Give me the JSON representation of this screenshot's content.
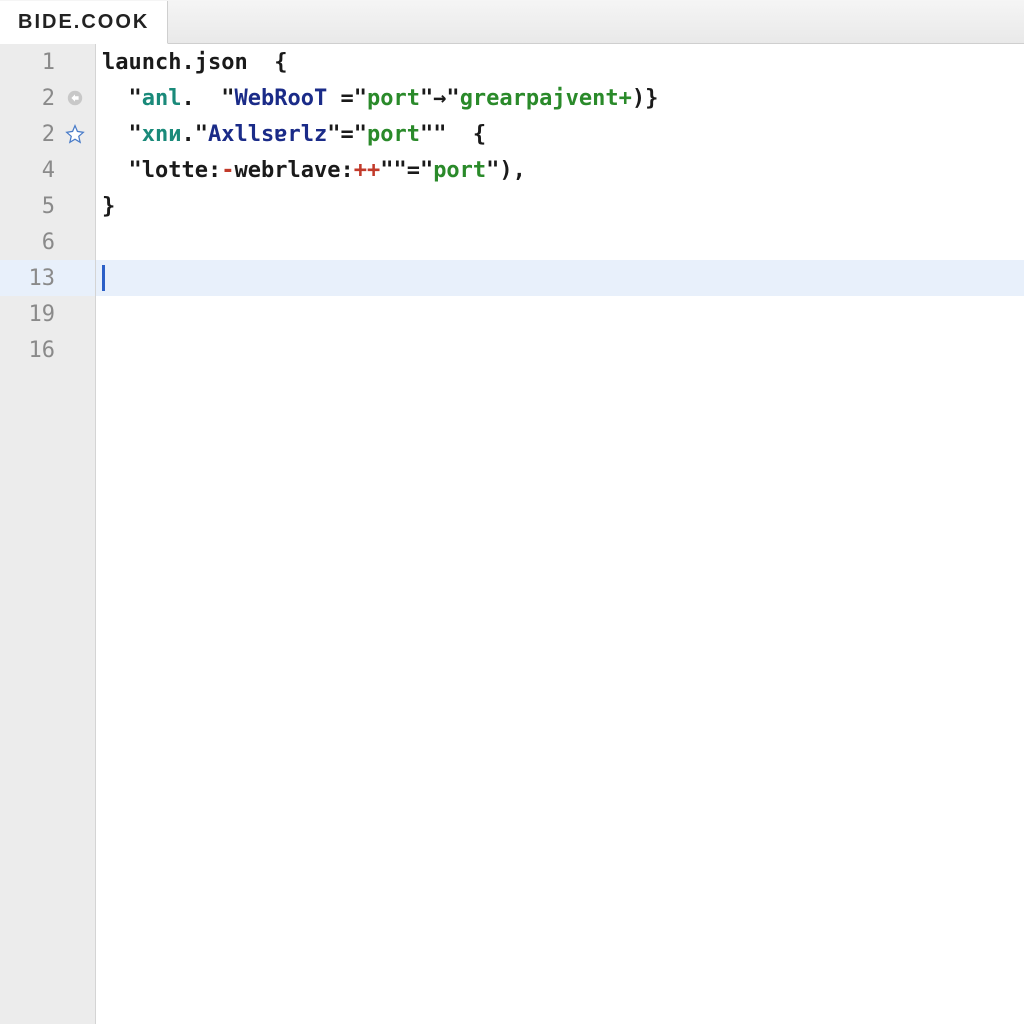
{
  "tab": {
    "title": "BIDE.COOK"
  },
  "gutter": {
    "lines": [
      "1",
      "2",
      "2",
      "4",
      "5",
      "6",
      "13",
      "19",
      "16"
    ],
    "activeIndex": 6
  },
  "code": {
    "rows": [
      {
        "type": "plain",
        "segments": [
          {
            "cls": "c-black",
            "t": "launch.json"
          },
          {
            "cls": "c-black",
            "t": "  {"
          }
        ]
      },
      {
        "type": "plain",
        "segments": [
          {
            "cls": "c-black",
            "t": "  \""
          },
          {
            "cls": "c-teal",
            "t": "anl"
          },
          {
            "cls": "c-black",
            "t": ".  \""
          },
          {
            "cls": "c-navy",
            "t": "WebRooT"
          },
          {
            "cls": "c-black",
            "t": " =\""
          },
          {
            "cls": "c-green",
            "t": "port"
          },
          {
            "cls": "c-black",
            "t": "\"→\""
          },
          {
            "cls": "c-green",
            "t": "grearpajvent+"
          },
          {
            "cls": "c-black",
            "t": ")}"
          }
        ]
      },
      {
        "type": "plain",
        "segments": [
          {
            "cls": "c-black",
            "t": "  \""
          },
          {
            "cls": "c-teal",
            "t": "xnи"
          },
          {
            "cls": "c-black",
            "t": ".\""
          },
          {
            "cls": "c-navy",
            "t": "Axllsɐrlz"
          },
          {
            "cls": "c-black",
            "t": "\"=\""
          },
          {
            "cls": "c-green",
            "t": "port"
          },
          {
            "cls": "c-black",
            "t": "\"\"  {"
          }
        ]
      },
      {
        "type": "plain",
        "segments": [
          {
            "cls": "c-black",
            "t": "  \""
          },
          {
            "cls": "c-black",
            "t": "lotte:"
          },
          {
            "cls": "c-red",
            "t": "-"
          },
          {
            "cls": "c-black",
            "t": "webrlave:"
          },
          {
            "cls": "c-red",
            "t": "++"
          },
          {
            "cls": "c-black",
            "t": "\"\"=\""
          },
          {
            "cls": "c-green",
            "t": "port"
          },
          {
            "cls": "c-black",
            "t": "\"),"
          }
        ]
      },
      {
        "type": "plain",
        "segments": [
          {
            "cls": "c-black",
            "t": "}"
          }
        ]
      },
      {
        "type": "empty"
      },
      {
        "type": "cursor"
      },
      {
        "type": "empty"
      },
      {
        "type": "empty"
      }
    ]
  },
  "icons": {
    "row1": "circle-arrow",
    "row2": "star"
  }
}
